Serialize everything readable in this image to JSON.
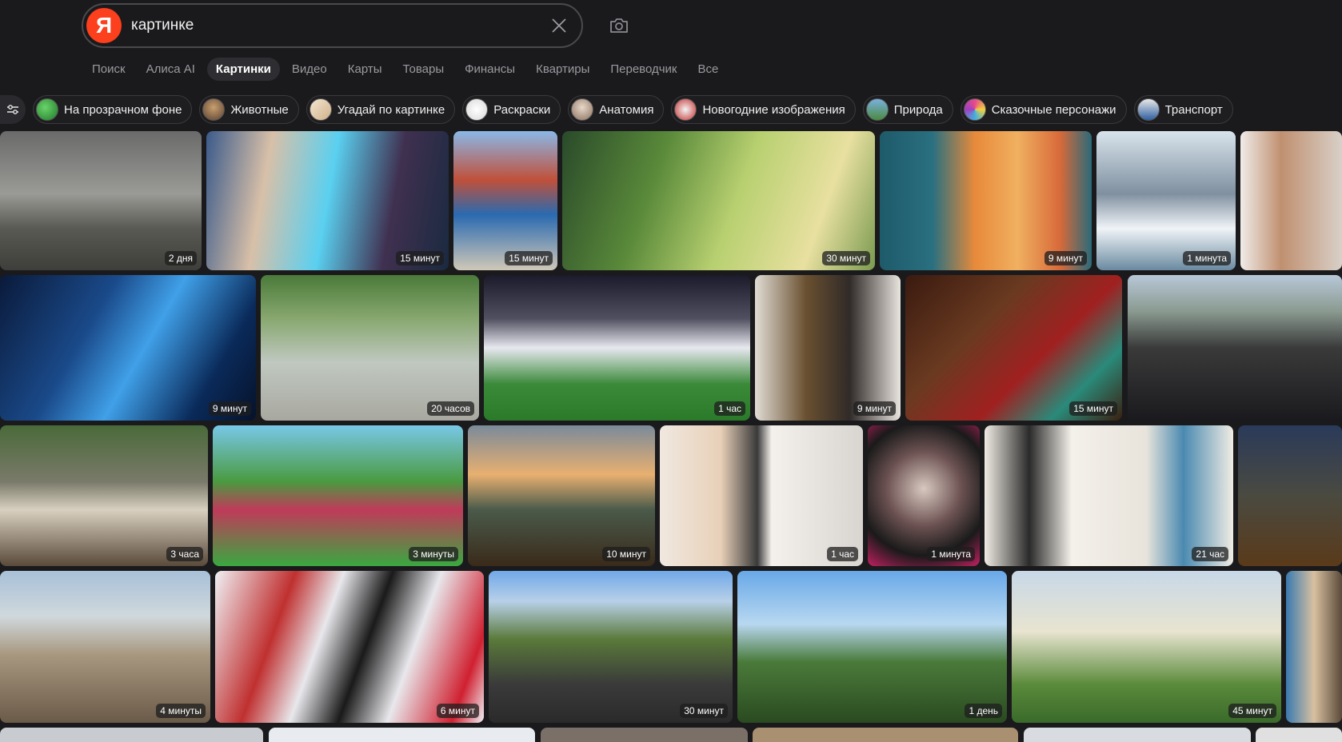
{
  "search": {
    "logo": "Я",
    "query": "картинке"
  },
  "nav": {
    "tabs": [
      {
        "label": "Поиск"
      },
      {
        "label": "Алиса AI"
      },
      {
        "label": "Картинки"
      },
      {
        "label": "Видео"
      },
      {
        "label": "Карты"
      },
      {
        "label": "Товары"
      },
      {
        "label": "Финансы"
      },
      {
        "label": "Квартиры"
      },
      {
        "label": "Переводчик"
      },
      {
        "label": "Все"
      }
    ],
    "active": "Картинки"
  },
  "chips": [
    {
      "label": "На прозрачном фоне"
    },
    {
      "label": "Животные"
    },
    {
      "label": "Угадай по картинке"
    },
    {
      "label": "Раскраски"
    },
    {
      "label": "Анатомия"
    },
    {
      "label": "Новогодние изображения"
    },
    {
      "label": "Природа"
    },
    {
      "label": "Сказочные персонажи"
    },
    {
      "label": "Транспорт"
    }
  ],
  "rows": [
    [
      {
        "time": "2 дня"
      },
      {
        "time": "15 минут"
      },
      {
        "time": "15 минут"
      },
      {
        "time": "30 минут"
      },
      {
        "time": "9 минут"
      },
      {
        "time": "1 минута"
      },
      {
        "time": ""
      }
    ],
    [
      {
        "time": "9 минут"
      },
      {
        "time": "20 часов"
      },
      {
        "time": "1 час"
      },
      {
        "time": "9 минут"
      },
      {
        "time": "15 минут"
      },
      {
        "time": ""
      }
    ],
    [
      {
        "time": "3 часа"
      },
      {
        "time": "3 минуты"
      },
      {
        "time": "10 минут"
      },
      {
        "time": "1 час"
      },
      {
        "time": "1 минута"
      },
      {
        "time": "21 час"
      },
      {
        "time": ""
      }
    ],
    [
      {
        "time": "4 минуты"
      },
      {
        "time": "6 минут"
      },
      {
        "time": "30 минут"
      },
      {
        "time": "1 день"
      },
      {
        "time": "45 минут"
      },
      {
        "time": ""
      }
    ]
  ],
  "colors": {
    "brand": "#fc3f1d",
    "background": "#1a1a1c"
  }
}
